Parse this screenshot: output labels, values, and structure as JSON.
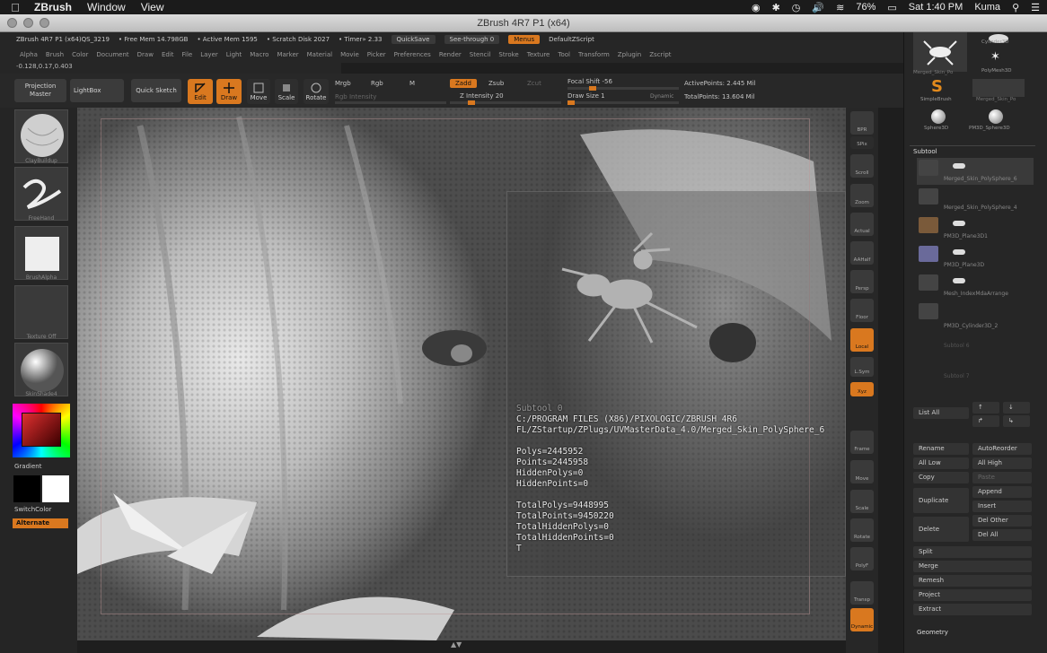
{
  "mac_menubar": {
    "app_name": "ZBrush",
    "menus": [
      "Window",
      "View"
    ],
    "battery": "76%",
    "clock": "Sat 1:40 PM",
    "user": "Kuma"
  },
  "window": {
    "title": "ZBrush 4R7 P1 (x64)"
  },
  "infobar": {
    "version": "ZBrush 4R7 P1 (x64)QS_3219",
    "free_mem": "• Free Mem 14.798GB",
    "active_mem": "• Active Mem 1595",
    "scratch_disk": "• Scratch Disk 2027",
    "timer": "• Timer» 2.33",
    "quicksave": "QuickSave",
    "see_through": "See-through  0",
    "menus": "Menus",
    "default_script": "DefaultZScript"
  },
  "menu_row": [
    "Alpha",
    "Brush",
    "Color",
    "Document",
    "Draw",
    "Edit",
    "File",
    "Layer",
    "Light",
    "Macro",
    "Marker",
    "Material",
    "Movie",
    "Picker",
    "Preferences",
    "Render",
    "Stencil",
    "Stroke",
    "Texture",
    "Tool",
    "Transform",
    "Zplugin",
    "Zscript"
  ],
  "coordinates": "-0.128,0.17,0.403",
  "toolbar": {
    "projection_master": "Projection Master",
    "lightbox": "LightBox",
    "quick_sketch": "Quick Sketch",
    "edit": "Edit",
    "draw": "Draw",
    "move": "Move",
    "scale": "Scale",
    "rotate": "Rotate",
    "mrgb": "Mrgb",
    "rgb": "Rgb",
    "m": "M",
    "rgb_intensity": "Rgb Intensity",
    "zadd": "Zadd",
    "zsub": "Zsub",
    "zcut": "Zcut",
    "z_intensity": "Z Intensity 20",
    "focal_shift": "Focal Shift -56",
    "draw_size": "Draw Size 1",
    "dynamic": "Dynamic",
    "active_points": "ActivePoints: 2.445 Mil",
    "total_points": "TotalPoints: 13.604 Mil"
  },
  "left_shelf": {
    "brush_label": "ClayBuildup",
    "stroke_label": "FreeHand",
    "alpha_label": "BrushAlpha",
    "texture_label": "Texture Off",
    "material_label": "SkinShade4",
    "gradient_label": "Gradient",
    "switch_color_label": "SwitchColor",
    "alternate_label": "Alternate"
  },
  "viewport_info": {
    "subtool": "Subtool 0",
    "path1": "C:/PROGRAM FILES (X86)/PIXOLOGIC/ZBRUSH 4R6",
    "path2": "FL/ZStartup/ZPlugs/UVMasterData_4.0/Merged_Skin_PolySphere_6",
    "polys": "Polys=2445952",
    "points": "Points=2445958",
    "hidden_polys": "HiddenPolys=0",
    "hidden_points": "HiddenPoints=0",
    "total_polys": "TotalPolys=9448995",
    "total_points": "TotalPoints=9450220",
    "total_hidden_polys": "TotalHiddenPolys=0",
    "total_hidden_points": "TotalHiddenPoints=0",
    "trailing": "T"
  },
  "right_strip": [
    "BPR",
    "SPix",
    "Scroll",
    "Zoom",
    "Actual",
    "AAHalf",
    "Persp",
    "Floor",
    "Local",
    "L.Sym",
    "Xyz",
    "Frame",
    "Move",
    "Scale",
    "Rotate",
    "PolyF",
    "Transp",
    "Dynamic"
  ],
  "rpanel": {
    "tool_thumbs": [
      "Merged_Skin_Po",
      "Cylinder3D",
      "PolyMesh3D",
      "SimpleBrush",
      "Merged_Skin_Po",
      "Sphere3D",
      "PM3D_Sphere3D"
    ],
    "subtool_title": "Subtool",
    "subtools": [
      "Merged_Skin_PolySphere_6",
      "Merged_Skin_PolySphere_4",
      "PM3D_Plane3D1",
      "PM3D_Plane3D",
      "Mesh_IndexMdaArrange",
      "PM3D_Cylinder3D_2",
      "Subtool 6",
      "Subtool 7"
    ],
    "list_all": "List All",
    "rename": "Rename",
    "auto_reorder": "AutoReorder",
    "all_low": "All Low",
    "all_high": "All High",
    "copy": "Copy",
    "paste": "Paste",
    "duplicate": "Duplicate",
    "append": "Append",
    "insert": "Insert",
    "delete": "Delete",
    "del_other": "Del Other",
    "del_all": "Del All",
    "split": "Split",
    "merge": "Merge",
    "remesh": "Remesh",
    "project": "Project",
    "extract": "Extract",
    "geometry": "Geometry"
  },
  "colors": {
    "accent": "#d9781f",
    "panel": "#262626",
    "button": "#3a3a3a"
  }
}
